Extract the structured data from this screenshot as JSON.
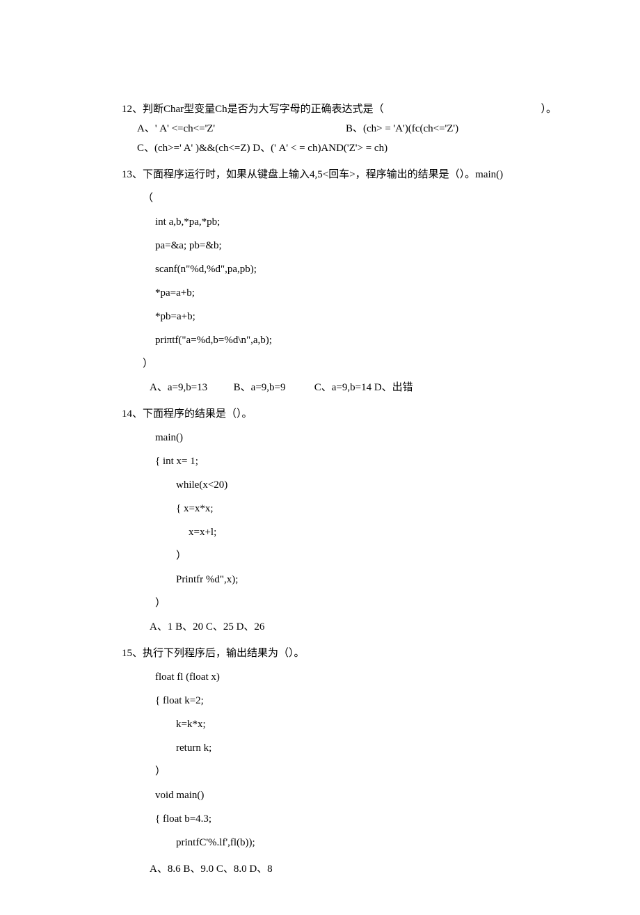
{
  "q12": {
    "prompt": "12、判断Char型变量Ch是否为大写字母的正确表达式是（",
    "blank_close": "）。",
    "optA": "A、' A' <=ch<='Z'",
    "optB": "B、(ch> = 'A')(fc(ch<='Z')",
    "optC": "C、(ch>=' A' )&&(ch<=Z) D、(' A' < = ch)AND('Z'> = ch)"
  },
  "q13": {
    "prompt": "13、下面程序运行时，如果从键盘上输入4,5<回车>，程序输出的结果是（）。main()",
    "brace_open": "（",
    "l1": "int a,b,*pa,*pb;",
    "l2": "pa=&a; pb=&b;",
    "l3": "scanf(n\"%d,%d\",pa,pb);",
    "l4": "*pa=a+b;",
    "l5": "*pb=a+b;",
    "l6": "priπtf(\"a=%d,b=%d\\n\",a,b);",
    "brace_close": "）",
    "opts": "A、a=9,b=13          B、a=9,b=9           C、a=9,b=14 D、出错"
  },
  "q14": {
    "prompt": "14、下面程序的结果是（）。",
    "l1": "main()",
    "l2": "{ int x= 1;",
    "l3": "while(x<20)",
    "l4": "{ x=x*x;",
    "l5": "x=x+l;",
    "l6": "）",
    "l7": "Printfr %d\",x);",
    "l8": "）",
    "opts": "A、1 B、20 C、25 D、26"
  },
  "q15": {
    "prompt": "15、执行下列程序后，输出结果为（）。",
    "l1": "float fl (float x)",
    "l2": "{ float k=2;",
    "l3": "k=k*x;",
    "l4": "return k;",
    "l5": "）",
    "l6": "void main()",
    "l7": "{ float b=4.3;",
    "l8": "printfC'%.lf',fl(b));",
    "opts": "A、8.6 B、9.0 C、8.0 D、8"
  }
}
